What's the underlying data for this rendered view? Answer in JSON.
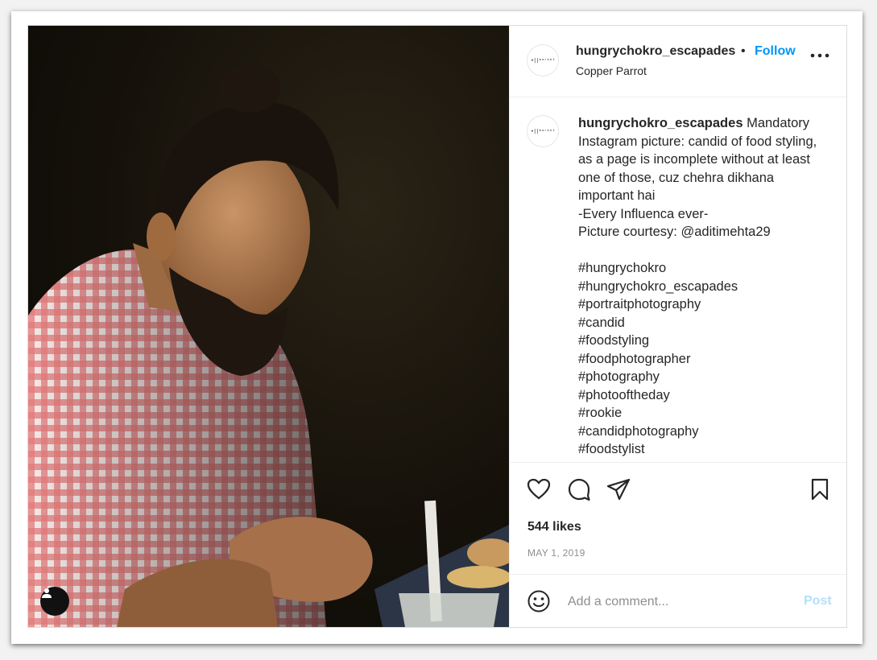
{
  "post": {
    "username": "hungrychokro_escapades",
    "dot": "•",
    "follow_label": "Follow",
    "location": "Copper Parrot",
    "avatar_text": "•||ᵐᵃʳᵏᵉᵗ",
    "caption": " Mandatory Instagram picture: candid of food styling, as a page is incomplete without at least one of those, cuz chehra dikhana important hai\n-Every Influenca ever-\nPicture courtesy: @aditimehta29\n\n#hungrychokro\n#hungrychokro_escapades\n#portraitphotography\n#candid\n#foodstyling\n#foodphotographer\n#photography\n#photooftheday\n#rookie\n#candidphotography\n#foodstylist",
    "likes": "544 likes",
    "date": "MAY 1, 2019"
  },
  "comment": {
    "placeholder": "Add a comment...",
    "post_label": "Post"
  },
  "icons": {
    "like": "heart-icon",
    "comment": "comment-bubble-icon",
    "share": "paper-plane-icon",
    "save": "bookmark-icon",
    "more": "more-options-icon",
    "emoji": "smiley-icon",
    "tag": "user-tag-icon"
  },
  "colors": {
    "accent": "#0095f6",
    "post_disabled": "#b2dffc",
    "text": "#262626",
    "muted": "#8e8e8e",
    "shirt_red": "#d94a4a"
  }
}
